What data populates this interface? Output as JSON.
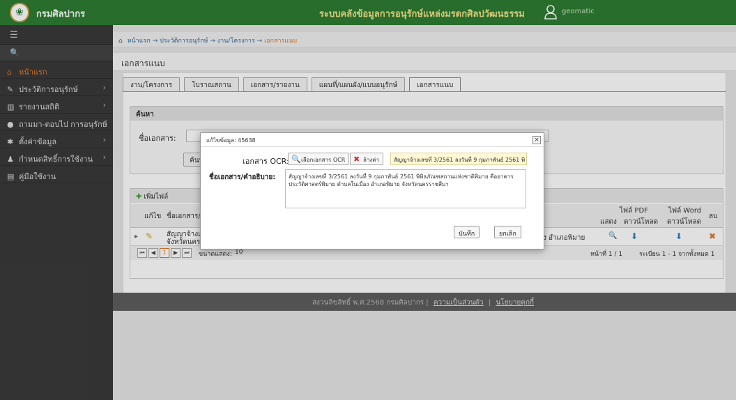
{
  "topbar": {
    "brand": "กรมศิลปากร",
    "system_title": "ระบบคลังข้อมูลการอนุรักษ์แหล่งมรดกศิลปวัฒนธรรม",
    "username": "geomatic"
  },
  "sidebar": {
    "toggle_icon": "☰",
    "search_icon": "🔍",
    "items": [
      {
        "icon": "⌂",
        "label": "หน้าแรก",
        "has_arrow": false
      },
      {
        "icon": "✎",
        "label": "ประวัติการอนุรักษ์",
        "has_arrow": true
      },
      {
        "icon": "▥",
        "label": "รายงานสถิติ",
        "has_arrow": true
      },
      {
        "icon": "●",
        "label": "ถามมา-ตอบไป การอนุรักษ์",
        "has_arrow": true
      },
      {
        "icon": "✱",
        "label": "ตั้งค่าข้อมูล",
        "has_arrow": true
      },
      {
        "icon": "♟",
        "label": "กำหนดสิทธิ์การใช้งาน",
        "has_arrow": true
      },
      {
        "icon": "▤",
        "label": "คู่มือใช้งาน",
        "has_arrow": false
      }
    ]
  },
  "breadcrumb": {
    "home": "หน้าแรก",
    "sep": " → ",
    "l1": "ประวัติการอนุรักษ์",
    "l2": "งาน/โครงการ",
    "current": "เอกสารแนบ"
  },
  "page_title": "เอกสารแนบ",
  "tabs": [
    "งาน/โครงการ",
    "โบราณสถาน",
    "เอกสาร/รายงาน",
    "แผนที่/แผนผัง/แบบอนุรักษ์",
    "เอกสารแนบ"
  ],
  "search": {
    "heading": "ค้นหา",
    "doc_label": "ชื่อเอกสาร:",
    "button": "ค้นห"
  },
  "files": {
    "add_label": "เพิ่มไฟล์",
    "col_edit": "แก้ไข",
    "col_name": "ชื่อเอกสาร/คำ",
    "col_pdf": "ไฟล์ PDF",
    "col_word": "ไฟล์ Word",
    "col_show": "แสดง",
    "col_download": "ดาวน์โหลด",
    "col_delete": "ลบ",
    "row_name_1": "สัญญาจ้างเลข",
    "row_name_2": "จังหวัดนครรา",
    "row_place": "ง อำเภอพิมาย",
    "page_size_label": "ขนาดแสดง:",
    "page_size_value": "10",
    "page_info": "หน้าที่ 1 / 1",
    "record_info": "ระเบียน 1 - 1 จากทั้งหมด 1",
    "current_page": "1"
  },
  "footer": {
    "copyright": "สงวนลิขสิทธิ์ พ.ศ.2568 กรมศิลปากร",
    "link1": "ความเป็นส่วนตัว",
    "link2": "นโยบายคุกกี้"
  },
  "modal": {
    "title": "แก้ไขข้อมูล: 45638",
    "close": "×",
    "ocr_label": "เอกสาร OCR:",
    "select_button": "เลือกเอกสาร OCR",
    "clear_button": "ล้างค่า",
    "ocr_filename": "สัญญาจ้างเลขที่ 3/2561 ลงวันที่ 9 กุมภาพันธ์ 2561 พิ",
    "name_label": "ชื่อเอกสาร/คำอธิบาย:",
    "description": "สัญญาจ้างเลขที่ 3/2561 ลงวันที่ 9 กุมภาพันธ์ 2561 พิพิธภัณฑสถานแห่งชาติพิมาย คืออาคารประวัติศาสตร์พิมาย ตำบลในเมือง อำเภอพิมาย จังหวัดนครราชสีมา",
    "save_button": "บันทึก",
    "cancel_button": "ยกเลิก"
  },
  "colors": {
    "topbar_green": "#2e7d32",
    "sidebar_dark": "#3a3a3a",
    "active_orange": "#e07a2e",
    "title_yellow": "#f4e38a"
  }
}
